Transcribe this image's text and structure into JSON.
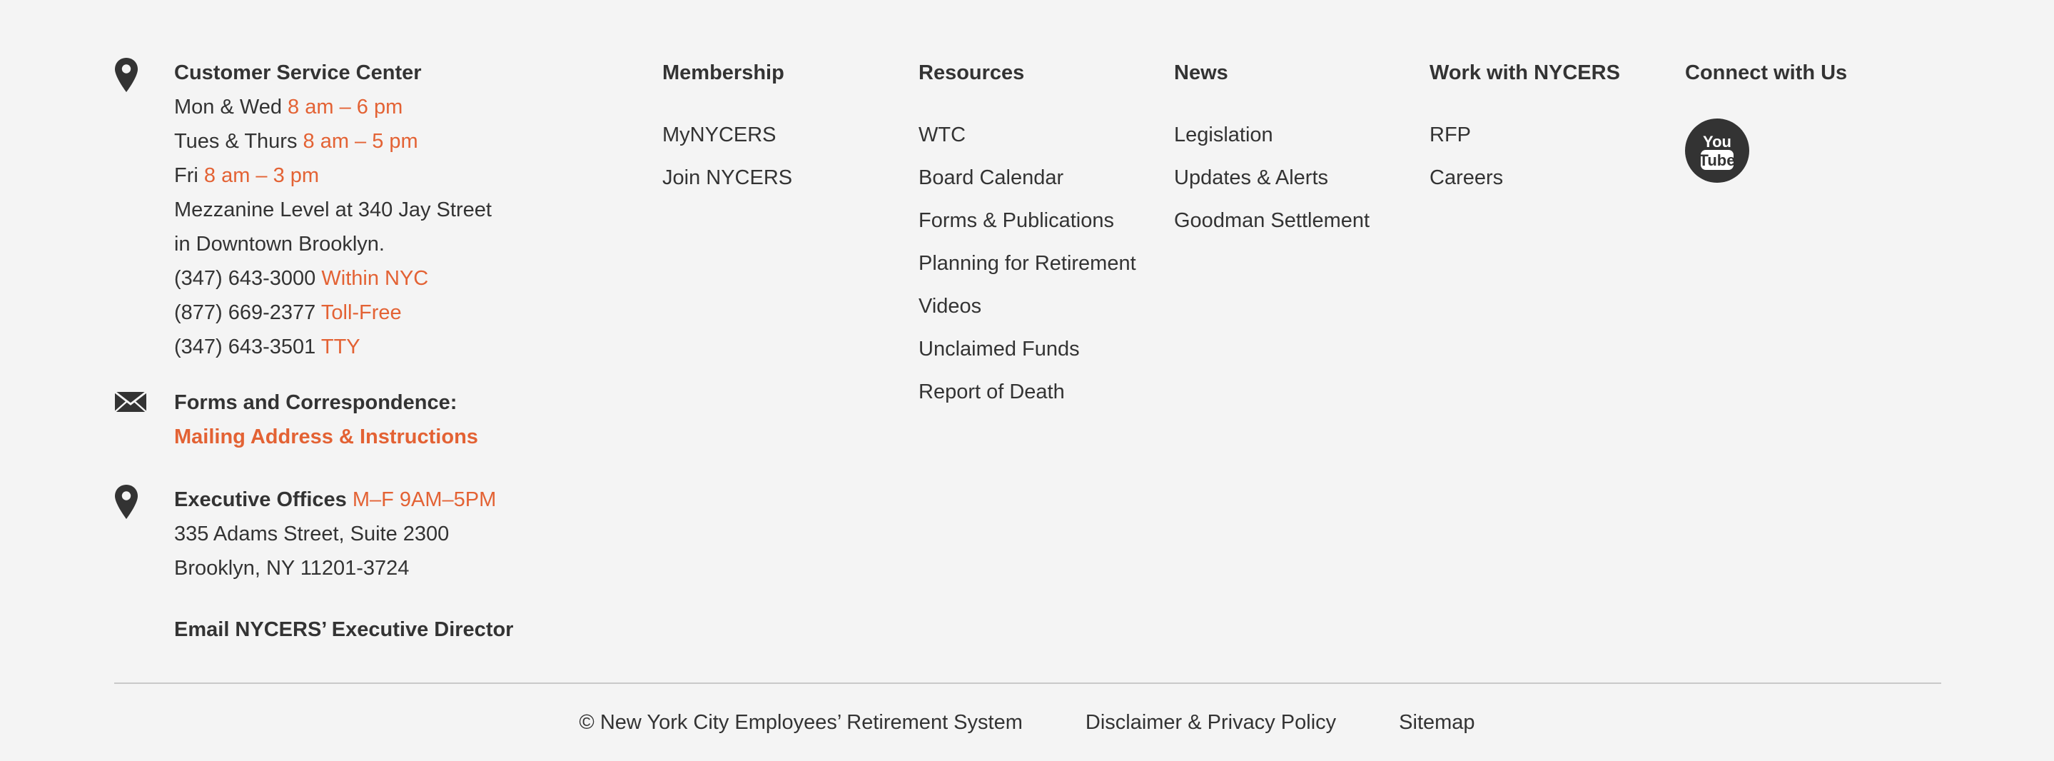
{
  "contact": {
    "service_center": {
      "title": "Customer Service Center",
      "hours": [
        {
          "days": "Mon & Wed",
          "time": "8 am – 6 pm"
        },
        {
          "days": "Tues & Thurs",
          "time": "8 am – 5 pm"
        },
        {
          "days": "Fri",
          "time": "8 am – 3 pm"
        }
      ],
      "address_line1": "Mezzanine Level at 340 Jay Street",
      "address_line2": "in Downtown Brooklyn.",
      "phones": [
        {
          "number": "(347) 643-3000",
          "label": "Within NYC"
        },
        {
          "number": "(877) 669-2377",
          "label": "Toll-Free"
        },
        {
          "number": "(347) 643-3501",
          "label": "TTY"
        }
      ],
      "icon": "map-pin-icon"
    },
    "forms": {
      "title": "Forms and Correspondence:",
      "link": "Mailing Address & Instructions",
      "icon": "envelope-icon"
    },
    "executive": {
      "title": "Executive Offices",
      "hours": "M–F 9AM–5PM",
      "address_line1": "335 Adams Street, Suite 2300",
      "address_line2": "Brooklyn, NY 11201-3724",
      "icon": "map-pin-icon"
    },
    "email_link": "Email NYCERS’ Executive Director"
  },
  "columns": {
    "membership": {
      "title": "Membership",
      "links": [
        "MyNYCERS",
        "Join NYCERS"
      ]
    },
    "resources": {
      "title": "Resources",
      "links": [
        "WTC",
        "Board Calendar",
        "Forms & Publications",
        "Planning for Retirement",
        "Videos",
        "Unclaimed Funds",
        "Report of Death"
      ]
    },
    "news": {
      "title": "News",
      "links": [
        "Legislation",
        "Updates & Alerts",
        "Goodman Settlement"
      ]
    },
    "work": {
      "title": "Work with NYCERS",
      "links": [
        "RFP",
        "Careers"
      ]
    },
    "connect": {
      "title": "Connect with Us",
      "youtube_icon": "youtube-icon",
      "youtube_text_top": "You",
      "youtube_text_bottom": "Tube"
    }
  },
  "bottom": {
    "copyright": "© New York City Employees’ Retirement System",
    "disclaimer": "Disclaimer & Privacy Policy",
    "sitemap": "Sitemap"
  },
  "colors": {
    "accent": "#e36234",
    "text": "#333333",
    "background": "#f4f4f4",
    "divider": "#c9c9c9"
  }
}
